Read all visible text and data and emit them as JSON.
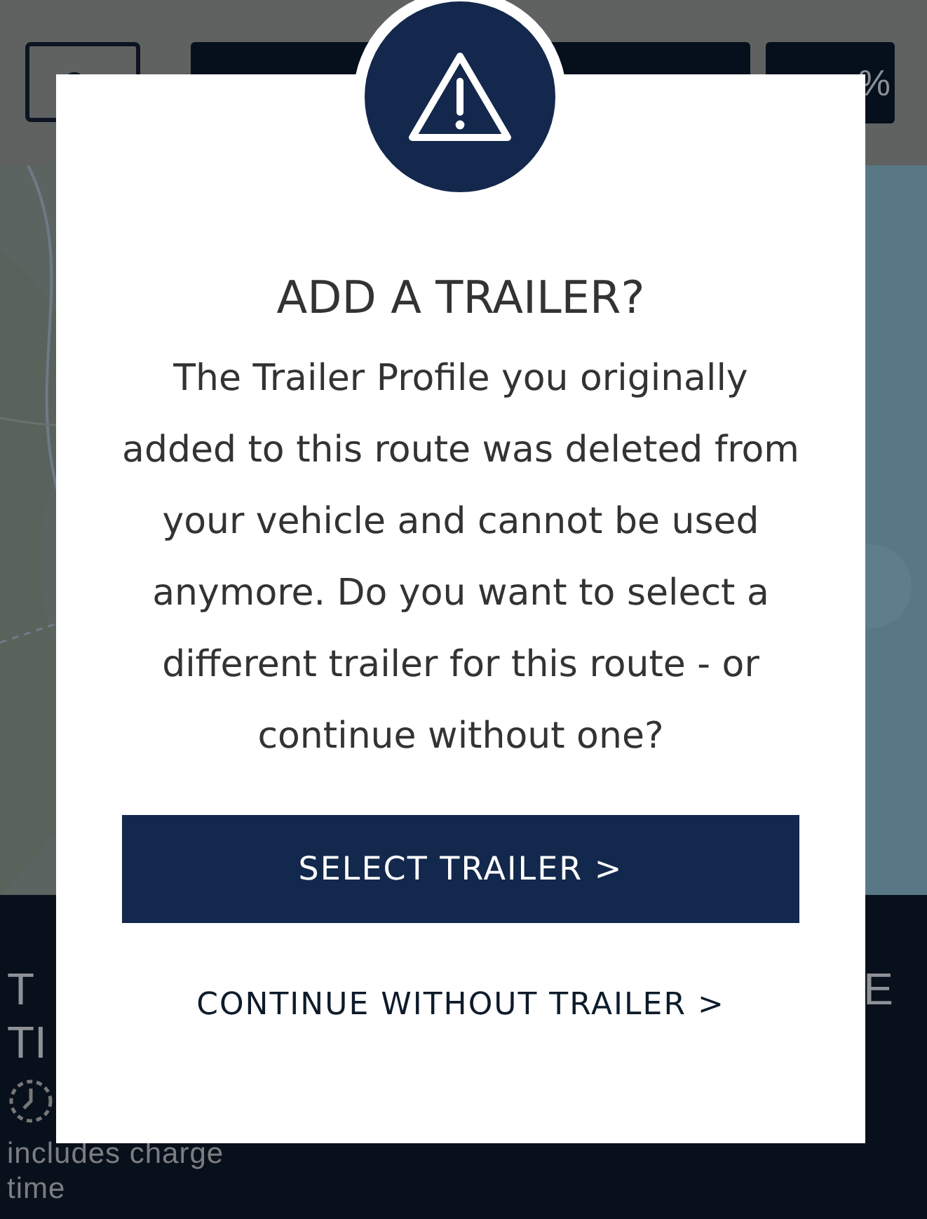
{
  "header": {
    "battery_stat": "%"
  },
  "summary": {
    "label_lines": [
      "T",
      "TI"
    ],
    "right_label": "E",
    "note": "includes charge time"
  },
  "dialog": {
    "title": "ADD A TRAILER?",
    "message": "The Trailer Profile you originally added to this route was deleted from your vehicle and cannot be used anymore. Do you want to select a different trailer for this route - or continue without one?",
    "primary_button": "SELECT TRAILER >",
    "secondary_button": "CONTINUE WITHOUT TRAILER >"
  }
}
